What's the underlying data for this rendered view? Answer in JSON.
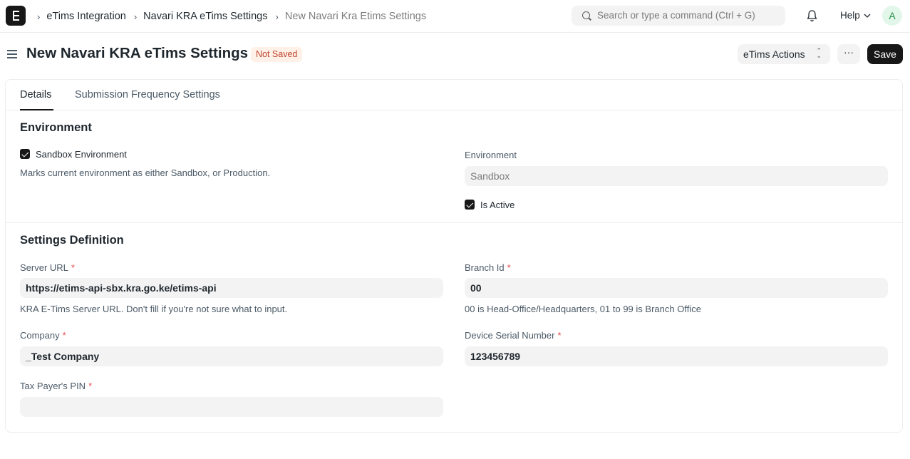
{
  "navbar": {
    "breadcrumbs": [
      "eTims Integration",
      "Navari KRA eTims Settings",
      "New Navari Kra Etims Settings"
    ],
    "search_placeholder": "Search or type a command (Ctrl + G)",
    "help_label": "Help",
    "avatar_initial": "A"
  },
  "header": {
    "title": "New Navari KRA eTims Settings",
    "status_badge": "Not Saved",
    "actions_label": "eTims Actions",
    "more_label": "···",
    "save_label": "Save"
  },
  "tabs": [
    "Details",
    "Submission Frequency Settings"
  ],
  "environment_section": {
    "title": "Environment",
    "sandbox_checkbox_label": "Sandbox Environment",
    "sandbox_checked": true,
    "sandbox_description": "Marks current environment as either Sandbox, or Production.",
    "environment_label": "Environment",
    "environment_value": "Sandbox",
    "is_active_label": "Is Active",
    "is_active_checked": true
  },
  "settings_section": {
    "title": "Settings Definition",
    "server_url_label": "Server URL",
    "server_url_value": "https://etims-api-sbx.kra.go.ke/etims-api",
    "server_url_description": "KRA E-Tims Server URL. Don't fill if you're not sure what to input.",
    "branch_id_label": "Branch Id",
    "branch_id_value": "00",
    "branch_id_description": "00 is Head-Office/Headquarters, 01 to 99 is Branch Office",
    "company_label": "Company",
    "company_value": "_Test Company",
    "device_serial_label": "Device Serial Number",
    "device_serial_value": "123456789",
    "tax_pin_label": "Tax Payer's PIN",
    "tax_pin_value": "",
    "required_marker": "*"
  }
}
